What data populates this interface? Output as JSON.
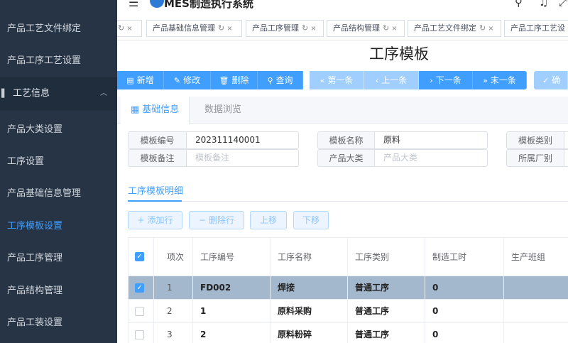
{
  "app": {
    "title": "MES制造执行系统"
  },
  "sidebar": {
    "items": [
      {
        "label": "产品工艺文件绑定"
      },
      {
        "label": "产品工序工艺设置"
      },
      {
        "label": "产品大类设置"
      },
      {
        "label": "工序设置"
      },
      {
        "label": "产品基础信息管理"
      },
      {
        "label": "工序模板设置"
      },
      {
        "label": "产品工序管理"
      },
      {
        "label": "产品结构管理"
      },
      {
        "label": "产品工装设置"
      }
    ],
    "group": {
      "label": "工艺信息"
    }
  },
  "tags": [
    {
      "label": ""
    },
    {
      "label": "产品基础信息管理"
    },
    {
      "label": "产品工序管理"
    },
    {
      "label": "产品结构管理"
    },
    {
      "label": "产品工艺文件绑定"
    },
    {
      "label": "产品工序工艺设"
    }
  ],
  "page": {
    "title": "工序模板"
  },
  "toolbar": {
    "add": "新增",
    "edit": "修改",
    "delete": "删除",
    "query": "查询",
    "first": "第一条",
    "prev": "上一条",
    "next": "下一条",
    "last": "末一条",
    "confirm": "确"
  },
  "tabs": [
    {
      "label": "基础信息"
    },
    {
      "label": "数据浏览"
    }
  ],
  "form": {
    "template_no_label": "模板编号",
    "template_no_value": "202311140001",
    "template_name_label": "模板名称",
    "template_name_value": "原料",
    "template_type_label": "模板类别",
    "template_remark_label": "模板备注",
    "template_remark_placeholder": "模板备注",
    "product_category_label": "产品大类",
    "product_category_placeholder": "产品大类",
    "factory_label": "所属厂别"
  },
  "detail": {
    "title": "工序模板明细",
    "add_row": "添加行",
    "delete_row": "删除行",
    "move_up": "上移",
    "move_down": "下移"
  },
  "table": {
    "columns": [
      "项次",
      "工序编号",
      "工序名称",
      "工序类别",
      "制造工时",
      "生产班组"
    ],
    "rows": [
      {
        "seq": "1",
        "code": "FD002",
        "name": "焊接",
        "type": "普通工序",
        "hours": "0",
        "team": "",
        "checked": true
      },
      {
        "seq": "2",
        "code": "1",
        "name": "原料采购",
        "type": "普通工序",
        "hours": "0",
        "team": "",
        "checked": false
      },
      {
        "seq": "3",
        "code": "2",
        "name": "原料粉碎",
        "type": "普通工序",
        "hours": "0",
        "team": "",
        "checked": false
      }
    ]
  },
  "colors": {
    "sidebar_bg": "#263445",
    "accent": "#409eff",
    "selected_row": "#a3b8cc"
  }
}
